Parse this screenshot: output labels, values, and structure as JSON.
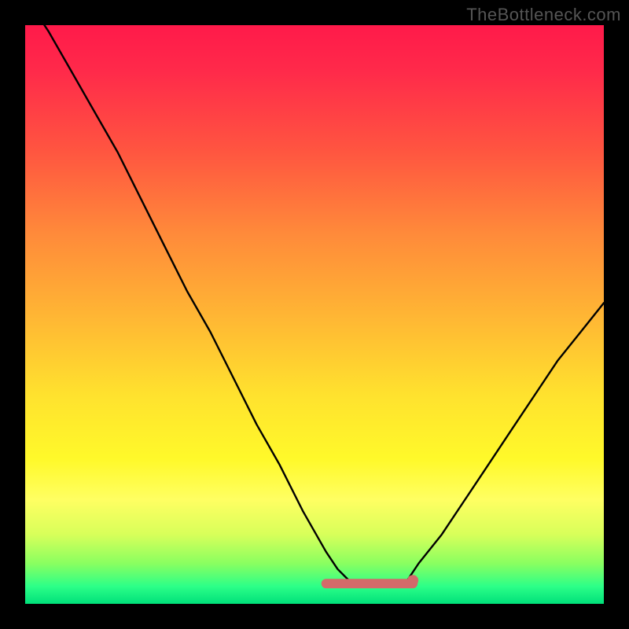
{
  "watermark": "TheBottleneck.com",
  "colors": {
    "frame": "#000000",
    "gradient_top": "#ff1a4a",
    "gradient_mid": "#ffe22e",
    "gradient_bottom": "#00e07a",
    "curve": "#000000",
    "flat_segment": "#d36a6a"
  },
  "chart_data": {
    "type": "line",
    "title": "",
    "xlabel": "",
    "ylabel": "",
    "xlim": [
      0,
      100
    ],
    "ylim": [
      0,
      100
    ],
    "series": [
      {
        "name": "bottleneck-curve",
        "x": [
          0,
          4,
          8,
          12,
          16,
          20,
          24,
          28,
          32,
          36,
          40,
          44,
          48,
          52,
          54,
          56,
          58,
          60,
          62,
          64,
          66,
          68,
          72,
          76,
          80,
          84,
          88,
          92,
          96,
          100
        ],
        "values": [
          105,
          99,
          92,
          85,
          78,
          70,
          62,
          54,
          47,
          39,
          31,
          24,
          16,
          9,
          6,
          4,
          3,
          3,
          3,
          3,
          4,
          7,
          12,
          18,
          24,
          30,
          36,
          42,
          47,
          52
        ]
      }
    ],
    "flat_segment": {
      "x_start": 52,
      "x_end": 67,
      "y": 3.5
    }
  }
}
